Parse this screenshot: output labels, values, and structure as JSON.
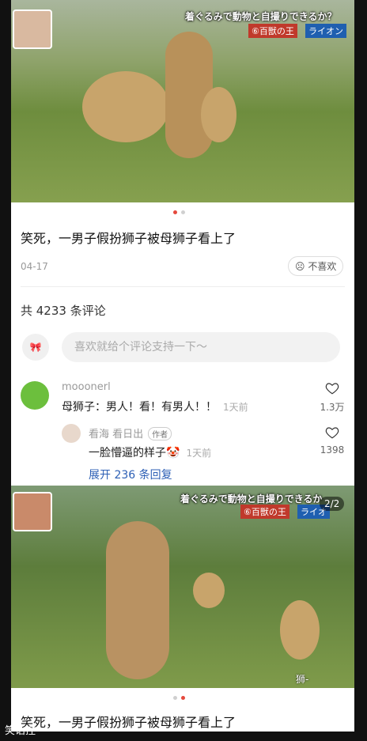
{
  "post1": {
    "overlay_title": "着ぐるみで動物と自撮りできるか？",
    "overlay_tag": "⑥百獣の王",
    "overlay_tag2": "ライオン",
    "title": "笑死，一男子假扮狮子被母狮子看上了",
    "date": "04-17",
    "dislike_label": "不喜欢"
  },
  "comments_section": {
    "count_label": "共 4233 条评论",
    "input_placeholder": "喜欢就给个评论支持一下～"
  },
  "comments": [
    {
      "author": "mooonerl",
      "text": "母狮子：男人！看！有男人！！",
      "time": "1天前",
      "likes": "1.3万"
    }
  ],
  "reply": {
    "author": "看海 看日出",
    "badge": "作者",
    "text": "一脸懵逼的样子",
    "emoji": "🤡",
    "time": "1天前",
    "likes": "1398"
  },
  "expand_label": "展开 236 条回复",
  "post2": {
    "overlay_title": "着ぐるみで動物と自撮りできるか",
    "overlay_tag": "⑥百獣の王",
    "overlay_tag2": "ライオ",
    "page_indicator": "2/2",
    "subtitle_fragment": "狮-",
    "title": "笑死，一男子假扮狮子被母狮子看上了"
  },
  "watermark": "笑话控"
}
